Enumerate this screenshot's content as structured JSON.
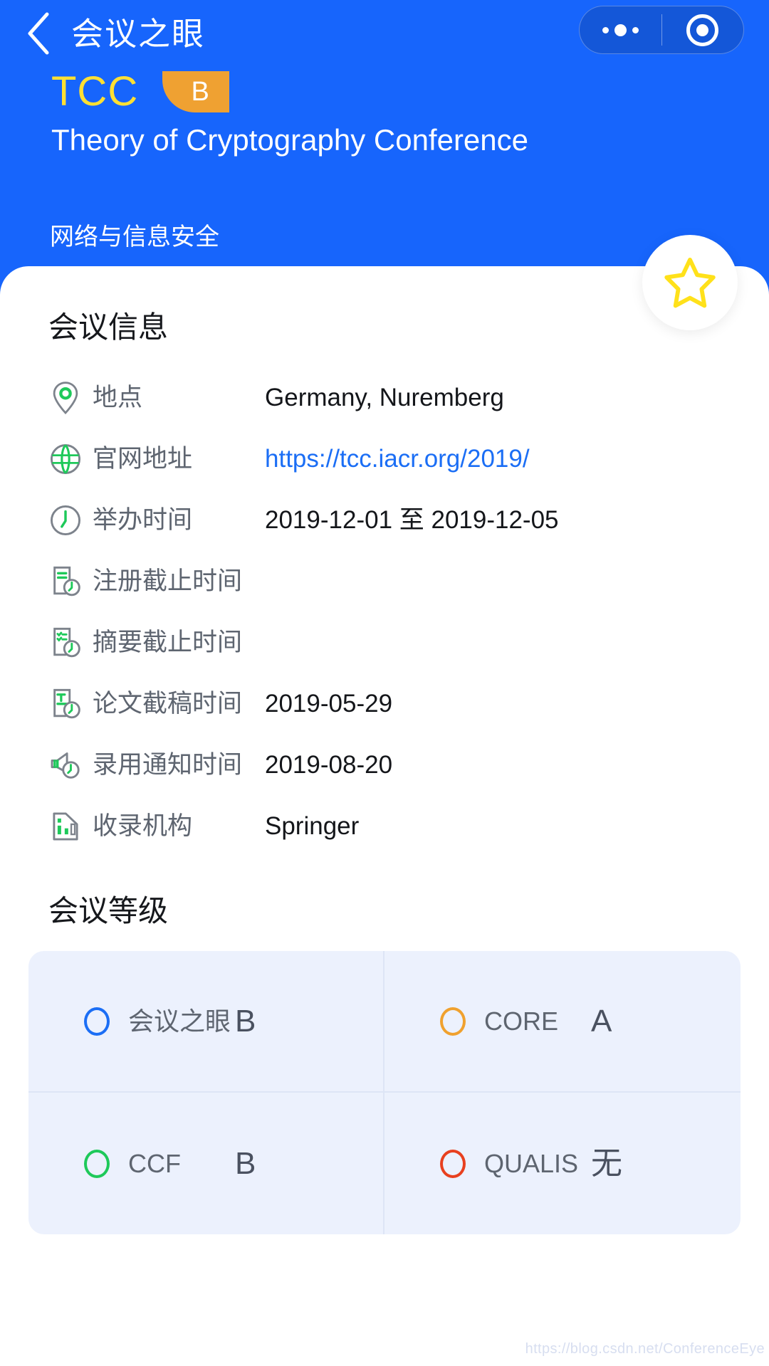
{
  "navbar": {
    "back_icon": "chevron-left-icon",
    "title": "会议之眼",
    "capsule": {
      "more_icon": "more-dots-icon",
      "target_icon": "target-circle-icon"
    }
  },
  "hero": {
    "abbreviation": "TCC",
    "rank_badge": "B",
    "full_name": "Theory of Cryptography Conference",
    "category": "网络与信息安全",
    "favorite_icon": "star-outline-icon",
    "background_color": "#1765fc",
    "abbr_color": "#ffe033",
    "badge_color": "#efa132",
    "star_color": "#ffe11a"
  },
  "info_section": {
    "title": "会议信息",
    "rows": [
      {
        "icon": "location-pin-icon",
        "label": "地点",
        "value": "Germany, Nuremberg",
        "is_link": false
      },
      {
        "icon": "globe-icon",
        "label": "官网地址",
        "value": "https://tcc.iacr.org/2019/",
        "is_link": true
      },
      {
        "icon": "clock-icon",
        "label": "举办时间",
        "value": "2019-12-01 至 2019-12-05",
        "is_link": false
      },
      {
        "icon": "document-clock-icon",
        "label": "注册截止时间",
        "value": "",
        "is_link": false
      },
      {
        "icon": "checklist-clock-icon",
        "label": "摘要截止时间",
        "value": "",
        "is_link": false
      },
      {
        "icon": "text-document-clock-icon",
        "label": "论文截稿时间",
        "value": "2019-05-29",
        "is_link": false
      },
      {
        "icon": "megaphone-clock-icon",
        "label": "录用通知时间",
        "value": "2019-08-20",
        "is_link": false
      },
      {
        "icon": "database-chart-icon",
        "label": "收录机构",
        "value": "Springer",
        "is_link": false
      }
    ]
  },
  "grade_section": {
    "title": "会议等级",
    "items": [
      {
        "ring_icon": "ring-icon",
        "name": "会议之眼",
        "value": "B",
        "color": "#1b6ef5"
      },
      {
        "ring_icon": "ring-icon",
        "name": "CORE",
        "value": "A",
        "color": "#f0a12e"
      },
      {
        "ring_icon": "ring-icon",
        "name": "CCF",
        "value": "B",
        "color": "#1ec95a"
      },
      {
        "ring_icon": "ring-icon",
        "name": "QUALIS",
        "value": "无",
        "color": "#e8401f"
      }
    ]
  },
  "watermark": "https://blog.csdn.net/ConferenceEye"
}
